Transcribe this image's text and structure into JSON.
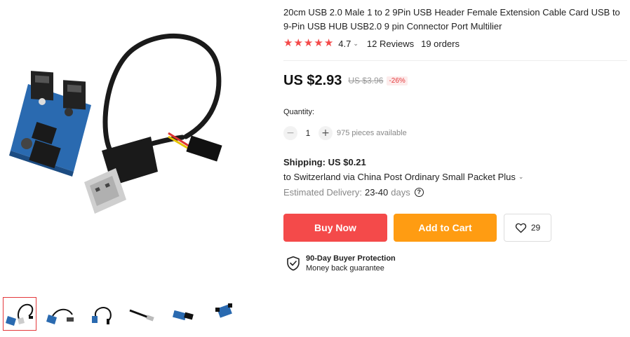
{
  "product": {
    "title": "20cm USB 2.0 Male 1 to 2 9Pin USB Header Female Extension Cable Card USB to 9-Pin USB HUB USB2.0 9 pin Connector Port Multilier",
    "rating": "4.7",
    "reviews": "12 Reviews",
    "orders": "19 orders",
    "stars": 5
  },
  "price": {
    "current": "US $2.93",
    "original": "US $3.96",
    "discount": "-26%"
  },
  "quantity": {
    "label": "Quantity:",
    "value": "1",
    "minus": "−",
    "plus": "+",
    "available": "975 pieces available"
  },
  "shipping": {
    "label": "Shipping:",
    "cost": "US $0.21",
    "destination": "to Switzerland via China Post Ordinary Small Packet Plus",
    "estimated_label": "Estimated Delivery:",
    "estimated_value": "23-40",
    "estimated_unit": "days",
    "help": "?"
  },
  "actions": {
    "buy_now": "Buy Now",
    "add_to_cart": "Add to Cart",
    "wishlist_count": "29"
  },
  "protection": {
    "title": "90-Day Buyer Protection",
    "subtitle": "Money back guarantee"
  },
  "gallery": {
    "thumb_count": 6,
    "selected": 1
  },
  "colors": {
    "buy": "#f44a4a",
    "cart": "#ff9c12",
    "star": "#f44a4a",
    "accent": "#e4393c"
  }
}
